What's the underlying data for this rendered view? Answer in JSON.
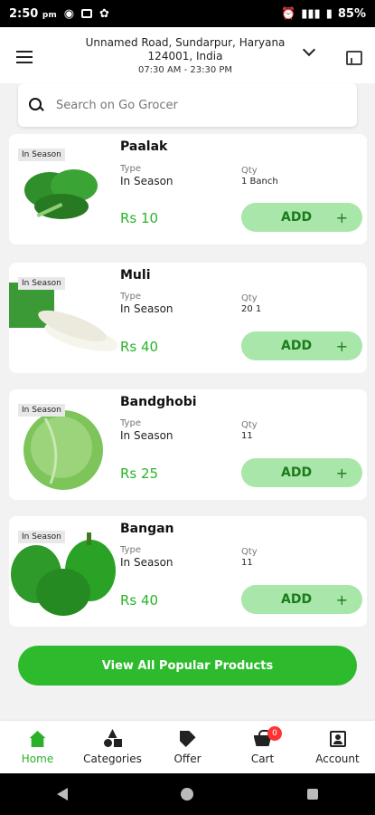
{
  "status_bar": {
    "time": "2:50",
    "time_suffix": "pm",
    "battery": "85%"
  },
  "header": {
    "address_line1": "Unnamed Road, Sundarpur, Haryana",
    "address_line2": "124001, India",
    "hours": "07:30 AM - 23:30 PM"
  },
  "search": {
    "placeholder": "Search on Go Grocer"
  },
  "colors": {
    "accent": "#2dbb2d",
    "add_bg": "#a9e6a9",
    "price": "#2ab42a",
    "badge": "#ff3333"
  },
  "products": [
    {
      "name": "Paalak",
      "badge": "In Season",
      "type_label": "Type",
      "type": "In Season",
      "qty_label": "Qty",
      "qty": "1 Banch",
      "price": "Rs 10",
      "add_label": "ADD",
      "plus": "+"
    },
    {
      "name": "Muli",
      "badge": "In Season",
      "type_label": "Type",
      "type": "In Season",
      "qty_label": "Qty",
      "qty": "20 1",
      "price": "Rs 40",
      "add_label": "ADD",
      "plus": "+"
    },
    {
      "name": "Bandghobi",
      "badge": "In Season",
      "type_label": "Type",
      "type": "In Season",
      "qty_label": "Qty",
      "qty": "11",
      "price": "Rs 25",
      "add_label": "ADD",
      "plus": "+"
    },
    {
      "name": "Bangan",
      "badge": "In Season",
      "type_label": "Type",
      "type": "In Season",
      "qty_label": "Qty",
      "qty": "11",
      "price": "Rs 40",
      "add_label": "ADD",
      "plus": "+"
    }
  ],
  "view_all_label": "View All Popular Products",
  "bottom_nav": [
    {
      "label": "Home",
      "icon": "home-icon"
    },
    {
      "label": "Categories",
      "icon": "categories-icon"
    },
    {
      "label": "Offer",
      "icon": "tag-icon"
    },
    {
      "label": "Cart",
      "icon": "cart-icon"
    },
    {
      "label": "Account",
      "icon": "account-icon"
    }
  ],
  "cart_count": "0"
}
